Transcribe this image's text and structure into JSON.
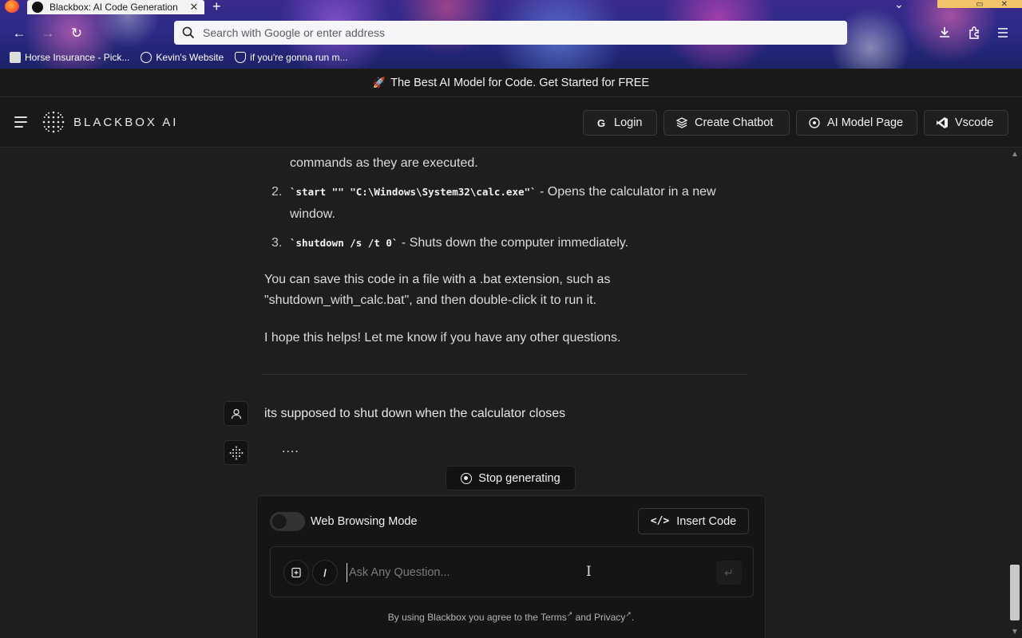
{
  "browser": {
    "tab_title": "Blackbox: AI Code Generation",
    "tab_close": "✕",
    "new_tab": "+",
    "back": "←",
    "forward": "→",
    "reload": "↻",
    "address_placeholder": "Search with Google or enter address",
    "bookmarks": [
      "Horse Insurance - Pick...",
      "Kevin's Website",
      "if you're gonna run m..."
    ]
  },
  "banner": {
    "text": "The Best AI Model for Code. Get Started for FREE"
  },
  "header": {
    "logo_text": "BLACKBOX AI",
    "buttons": [
      "Login",
      "Create Chatbot",
      "AI Model Page",
      "Vscode"
    ]
  },
  "chat": {
    "clipped_line": "commands as they are executed.",
    "list": [
      {
        "num": "2.",
        "code": "`start \"\" \"C:\\Windows\\System32\\calc.exe\"`",
        "rest": " - Opens the calculator in a new window."
      },
      {
        "num": "3.",
        "code": "`shutdown /s /t 0`",
        "rest": " - Shuts down the computer immediately."
      }
    ],
    "para1": "You can save this code in a file with a .bat extension, such as \"shutdown_with_calc.bat\", and then double-click it to run it.",
    "para2": "I hope this helps! Let me know if you have any other questions.",
    "user_message": "its supposed to shut down when the calculator closes",
    "typing": "...."
  },
  "composer": {
    "stop_label": "Stop generating",
    "web_mode_label": "Web Browsing Mode",
    "web_mode_on": false,
    "insert_code_label": "Insert Code",
    "slash_label": "/",
    "input_placeholder": "Ask Any Question...",
    "terms_prefix": "By using Blackbox you agree to the ",
    "terms_link": "Terms",
    "terms_mid": " and ",
    "privacy_link": "Privacy",
    "terms_suffix": "."
  }
}
